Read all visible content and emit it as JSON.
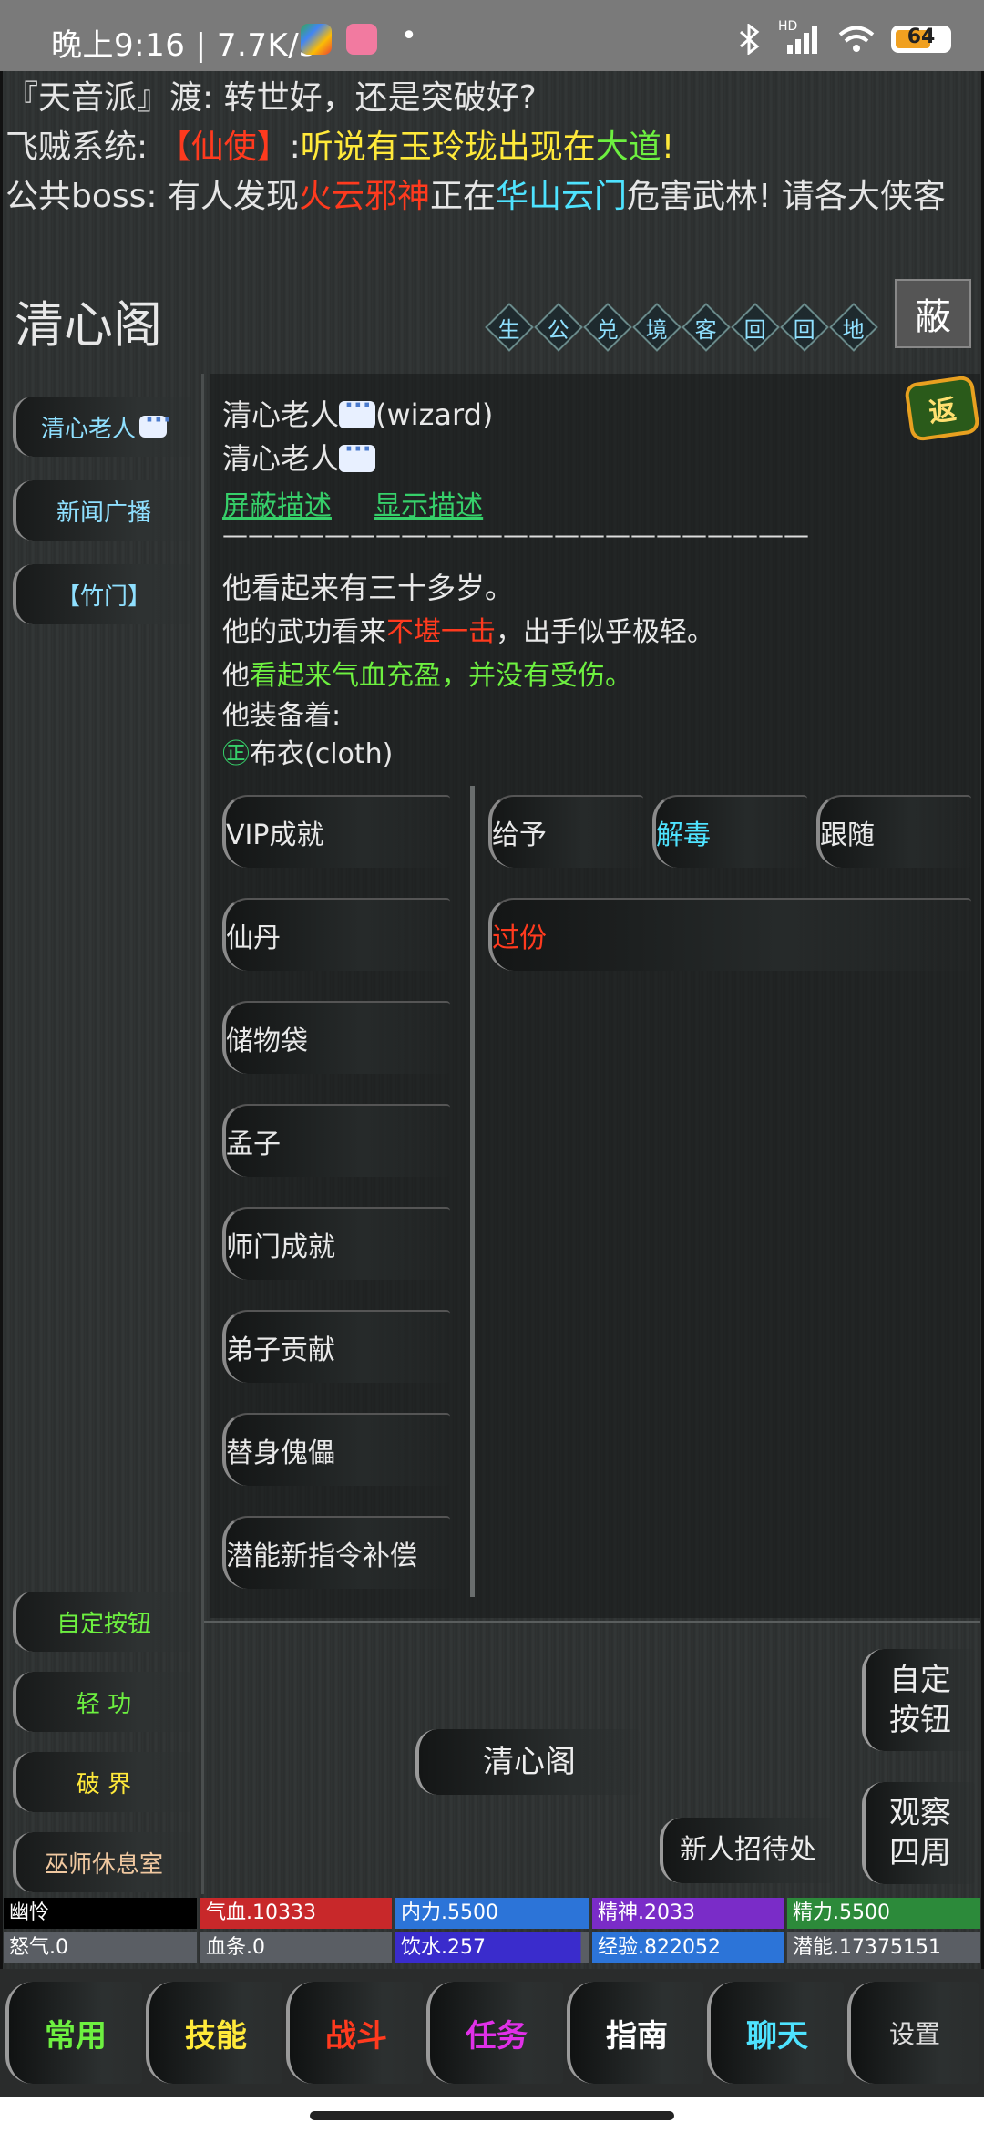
{
  "status_bar": {
    "time": "晚上9:16 | 7.7K/s",
    "dot": "•",
    "battery": "64",
    "hd_label": "HD"
  },
  "news": {
    "line1": {
      "prefix": "『天音派』渡",
      "text": ": 转世好，还是突破好?"
    },
    "line2": {
      "prefix": "飞贼系统: ",
      "bracket_l": "【",
      "name": "仙使",
      "bracket_r": "】",
      "colon": ":",
      "text": "听说有玉玲珑出现在",
      "place": "大道",
      "end": "!"
    },
    "line3": {
      "prefix": "公共boss: 有人发现",
      "boss": "火云邪神",
      "mid": "正在",
      "place": "华山云门",
      "end": "危害武林! 请各大侠客"
    }
  },
  "location": {
    "title": "清心阁",
    "exits": [
      "生",
      "公",
      "兑",
      "境",
      "客",
      "回",
      "回",
      "地"
    ],
    "mask_label": "蔽"
  },
  "left_nav": {
    "top": [
      "清心老人",
      "新闻广播",
      "【竹门】"
    ],
    "bottom": [
      "自定按钮",
      "轻  功",
      "破  界",
      "巫师休息室"
    ]
  },
  "info": {
    "name_line1": "清心老人",
    "name_suffix": "(wizard)",
    "name_line2": "清心老人",
    "link_hide": "屏蔽描述",
    "link_show": "显示描述",
    "separator": "———————————————————————",
    "desc1": "他看起来有三十多岁。",
    "desc2_a": "他的武功看来",
    "desc2_b": "不堪一击",
    "desc2_c": "，出手似乎极轻。",
    "desc3_a": "他",
    "desc3_b": "看起来气血充盈，并没有受伤。",
    "desc4": "他装备着:",
    "equip_icon": "㊣",
    "equip": "布衣(cloth)",
    "return_badge": "返"
  },
  "actions_left": [
    "VIP成就",
    "仙丹",
    "储物袋",
    "孟子",
    "师门成就",
    "弟子贡献",
    "替身傀儡",
    "潜能新指令补偿"
  ],
  "actions_right": {
    "give": "给予",
    "detox": "解毒",
    "follow": "跟随",
    "excess": "过份"
  },
  "bottom_area": {
    "room": "清心阁",
    "custom_l1": "自定",
    "custom_l2": "按钮",
    "observe_l1": "观察",
    "observe_l2": "四周",
    "newbie": "新人招待处"
  },
  "stats": {
    "name": "幽怜",
    "hp": "气血.10333",
    "neili": "内力.5500",
    "jingshen": "精神.2033",
    "jingli": "精力.5500",
    "nuqi": "怒气.0",
    "xuetiao": "血条.0",
    "water": "饮水.257",
    "exp": "经验.822052",
    "potential": "潜能.17375151"
  },
  "colors": {
    "hp": "#c8282a",
    "neili": "#2c74d8",
    "jingshen": "#7a2cc8",
    "jingli": "#2c8a3a",
    "gray": "#5a5e64",
    "water": "#3a2ccc",
    "exp": "#2c74d8"
  },
  "tabs": [
    {
      "label": "常用",
      "color": "#6df040"
    },
    {
      "label": "技能",
      "color": "#ffe93a"
    },
    {
      "label": "战斗",
      "color": "#ff3a1e"
    },
    {
      "label": "任务",
      "color": "#e030e8"
    },
    {
      "label": "指南",
      "color": "#ffffff"
    },
    {
      "label": "聊天",
      "color": "#4ee3ff"
    },
    {
      "label": "设置",
      "color": "#dddddd"
    }
  ]
}
